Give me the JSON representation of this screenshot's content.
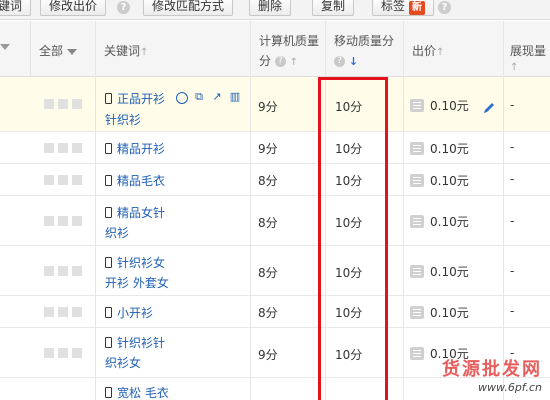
{
  "toolbar": {
    "cut_label": "键词",
    "edit_bid_label": "修改出价",
    "edit_match_label": "修改匹配方式",
    "delete_label": "删除",
    "copy_label": "复制",
    "tag_label": "标签",
    "new_badge": "新"
  },
  "header": {
    "all_label": "全部",
    "keyword_label": "关键词",
    "pc_quality_label_1": "计算机质量",
    "pc_quality_label_2": "分",
    "mobile_quality_label": "移动质量分",
    "bid_label": "出价",
    "impressions_label": "展现量",
    "sort_up": "↑",
    "sort_down": "↓"
  },
  "rows": [
    {
      "kw_line1": "正品开衫",
      "kw_line2": "针织衫",
      "pc": "9分",
      "mobile": "10分",
      "bid": "0.10元",
      "imp": "-"
    },
    {
      "kw_line1": "精品开衫",
      "kw_line2": "",
      "pc": "9分",
      "mobile": "10分",
      "bid": "0.10元",
      "imp": "-"
    },
    {
      "kw_line1": "精品毛衣",
      "kw_line2": "",
      "pc": "8分",
      "mobile": "10分",
      "bid": "0.10元",
      "imp": "-"
    },
    {
      "kw_line1": "精品女针",
      "kw_line2": "织衫",
      "pc": "8分",
      "mobile": "10分",
      "bid": "0.10元",
      "imp": "-"
    },
    {
      "kw_line1": "针织衫女",
      "kw_line2": "开衫 外套女",
      "pc": "8分",
      "mobile": "10分",
      "bid": "0.10元",
      "imp": "-"
    },
    {
      "kw_line1": "小开衫",
      "kw_line2": "",
      "pc": "8分",
      "mobile": "10分",
      "bid": "0.10元",
      "imp": "-"
    },
    {
      "kw_line1": "针织衫针",
      "kw_line2": "织衫女",
      "pc": "9分",
      "mobile": "10分",
      "bid": "0.10元",
      "imp": "-"
    },
    {
      "kw_line1": "宽松 毛衣",
      "kw_line2": "",
      "pc": "",
      "mobile": "",
      "bid": "",
      "imp": ""
    }
  ],
  "watermark": {
    "main": "货源批发网",
    "url": "www.6pf.cn"
  },
  "icons": [
    "help-icon",
    "phone-icon",
    "globe-icon",
    "copy-icon",
    "chart-icon",
    "trash-icon",
    "edit-icon",
    "bid-icon",
    "dropdown-icon"
  ],
  "colors": {
    "highlight_box": "#e4121c",
    "link": "#1f5fb4",
    "row_highlight": "#fffdea",
    "badge": "#e54b21"
  }
}
